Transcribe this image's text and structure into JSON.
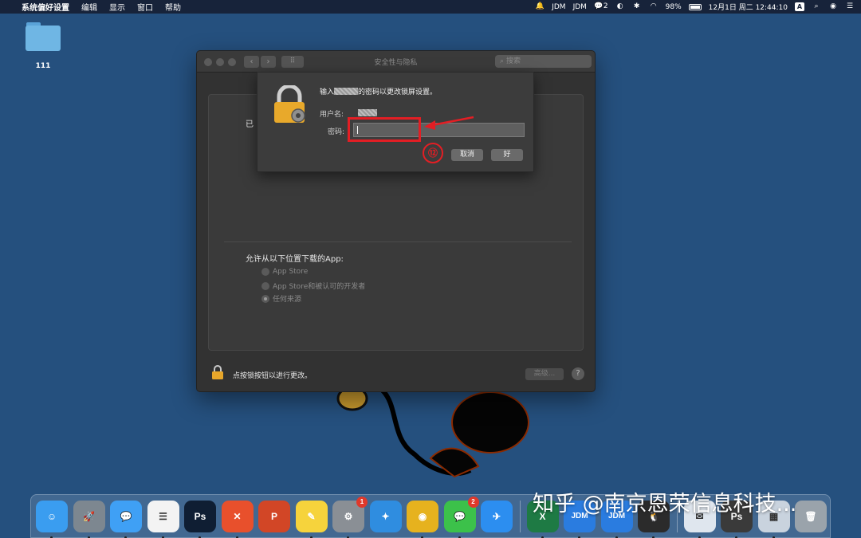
{
  "menubar": {
    "app_name": "系统偏好设置",
    "menus": [
      "编辑",
      "显示",
      "窗口",
      "帮助"
    ],
    "status": {
      "jdm1": "JDM",
      "jdm2": "JDM",
      "wechat_count": "2",
      "battery": "98%",
      "datetime": "12月1日 周二  12:44:10",
      "input_method": "A"
    }
  },
  "desktop": {
    "folder_label": "111"
  },
  "window": {
    "title": "安全性与隐私",
    "search_placeholder": "搜索",
    "partial_text": "已",
    "allow_label": "允许从以下位置下载的App:",
    "options": [
      "App Store",
      "App Store和被认可的开发者",
      "任何来源"
    ],
    "selected_option": "任何来源",
    "footer_text": "点按锁按钮以进行更改。",
    "advanced_label": "高级...",
    "help_label": "?"
  },
  "sheet": {
    "message_prefix": "输入",
    "message_suffix": "的密码以更改锁屏设置。",
    "username_label": "用户名:",
    "password_label": "密码:",
    "password_value": "",
    "cancel_label": "取消",
    "ok_label": "好"
  },
  "annotation": {
    "step_number": "⑫",
    "color": "#e31e24"
  },
  "dock": {
    "items": [
      {
        "name": "finder",
        "glyph": "☺",
        "color": "#3a9df0",
        "badge": ""
      },
      {
        "name": "launchpad",
        "glyph": "🚀",
        "color": "#7d8790",
        "badge": ""
      },
      {
        "name": "messages",
        "glyph": "💬",
        "color": "#3fa0f5",
        "badge": ""
      },
      {
        "name": "reminders",
        "glyph": "☰",
        "color": "#f3f3f3",
        "badge": ""
      },
      {
        "name": "photoshop",
        "glyph": "Ps",
        "color": "#0f1e33",
        "badge": ""
      },
      {
        "name": "xmind",
        "glyph": "✕",
        "color": "#e8502c",
        "badge": ""
      },
      {
        "name": "powerpoint",
        "glyph": "P",
        "color": "#d24626",
        "badge": ""
      },
      {
        "name": "notes",
        "glyph": "✎",
        "color": "#f6d33c",
        "badge": ""
      },
      {
        "name": "system-preferences",
        "glyph": "⚙",
        "color": "#8a8f95",
        "badge": "1"
      },
      {
        "name": "safari",
        "glyph": "✦",
        "color": "#2f8de0",
        "badge": ""
      },
      {
        "name": "chrome",
        "glyph": "◉",
        "color": "#e6b21e",
        "badge": ""
      },
      {
        "name": "wechat",
        "glyph": "💬",
        "color": "#3cc14a",
        "badge": "2"
      },
      {
        "name": "dingtalk",
        "glyph": "✈",
        "color": "#2c8ef0",
        "badge": ""
      },
      {
        "name": "excel",
        "glyph": "X",
        "color": "#1e7a44",
        "badge": ""
      },
      {
        "name": "jdm1",
        "glyph": "JDM",
        "color": "#2a7ce0",
        "badge": ""
      },
      {
        "name": "jdm2",
        "glyph": "JDM",
        "color": "#2a7ce0",
        "badge": ""
      },
      {
        "name": "qq",
        "glyph": "🐧",
        "color": "#2b2b2b",
        "badge": ""
      },
      {
        "name": "mail",
        "glyph": "✉",
        "color": "#dfe6ee",
        "badge": ""
      },
      {
        "name": "photoshop-doc",
        "glyph": "Ps",
        "color": "#3a3a3a",
        "badge": ""
      },
      {
        "name": "preview",
        "glyph": "▦",
        "color": "#c9d3de",
        "badge": ""
      },
      {
        "name": "trash",
        "glyph": "🗑",
        "color": "#9aa3ab",
        "badge": ""
      }
    ]
  },
  "watermark": "知乎 @南京恩荣信息科技..."
}
